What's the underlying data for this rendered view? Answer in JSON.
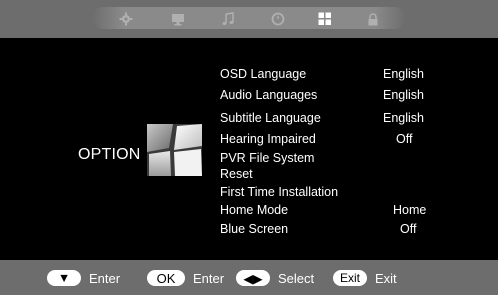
{
  "top_tabs": [
    {
      "icon": "gear-icon"
    },
    {
      "icon": "monitor-icon"
    },
    {
      "icon": "music-note-icon"
    },
    {
      "icon": "clock-icon"
    },
    {
      "icon": "option-grid-icon",
      "active": true
    },
    {
      "icon": "lock-icon"
    }
  ],
  "section": {
    "label": "OPTION"
  },
  "menu": [
    {
      "label": "OSD Language",
      "value": "English"
    },
    {
      "label": "Audio Languages",
      "value": "English"
    },
    {
      "label": "Subtitle Language",
      "value": "English"
    },
    {
      "label": "Hearing Impaired",
      "value": "Off"
    },
    {
      "label": "PVR File System",
      "value": ""
    },
    {
      "label": "Reset",
      "value": ""
    },
    {
      "label": "First Time Installation",
      "value": ""
    },
    {
      "label": "Home Mode",
      "value": "Home"
    },
    {
      "label": "Blue Screen",
      "value": "Off"
    }
  ],
  "footer": {
    "down_key": "▼",
    "down_label": "Enter",
    "ok_key": "OK",
    "ok_label": "Enter",
    "lr_key": "◀▶",
    "lr_label": "Select",
    "exit_key": "Exit",
    "exit_label": "Exit"
  },
  "colors": {
    "bar": "#6d6d6d",
    "background": "#000000",
    "text": "#ffffff"
  }
}
